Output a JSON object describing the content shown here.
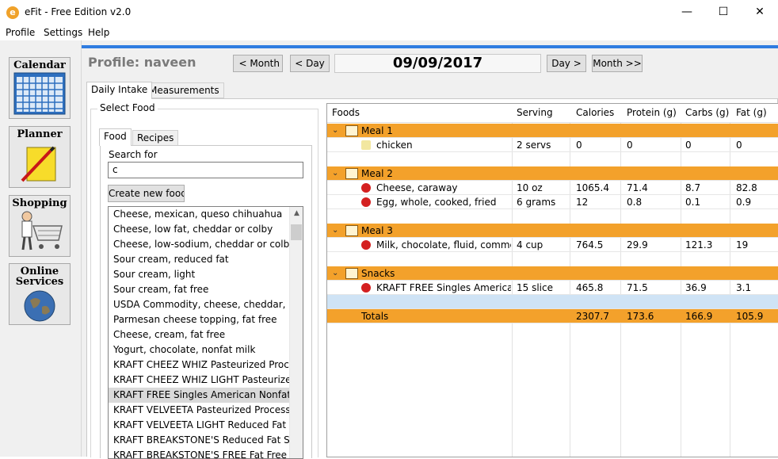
{
  "window": {
    "title": "eFit - Free Edition v2.0",
    "minimize": "—",
    "maximize": "☐",
    "close": "✕",
    "icon_letter": "e"
  },
  "menu": [
    "Profile",
    "Settings",
    "Help"
  ],
  "nav": {
    "calendar": "Calendar",
    "planner": "Planner",
    "shopping": "Shopping",
    "online_1": "Online",
    "online_2": "Services"
  },
  "profile": {
    "label": "Profile: naveen"
  },
  "date_nav": {
    "prev_month": "< Month",
    "prev_day": "< Day",
    "date": "09/09/2017",
    "next_day": "Day >",
    "next_month": "Month >>"
  },
  "tabs": {
    "daily": "Daily Intake",
    "measure": "Measurements"
  },
  "select_food": {
    "group_title": "Select Food",
    "tab_food": "Food",
    "tab_recipes": "Recipes",
    "search_label": "Search for",
    "search_value": "c",
    "create_button": "Create new food",
    "results": [
      "Cheese, mexican, queso chihuahua",
      "Cheese, low fat, cheddar or colby",
      "Cheese, low-sodium, cheddar or colby",
      "Sour cream, reduced fat",
      "Sour cream, light",
      "Sour cream, fat free",
      "USDA Commodity, cheese, cheddar, reduc",
      "Parmesan cheese topping, fat free",
      "Cheese, cream, fat free",
      "Yogurt, chocolate, nonfat milk",
      "KRAFT CHEEZ WHIZ Pasteurized Process C",
      "KRAFT CHEEZ WHIZ LIGHT Pasteurized Pr",
      "KRAFT FREE Singles American Nonfat Past",
      "KRAFT VELVEETA Pasteurized Process Chee",
      "KRAFT VELVEETA LIGHT Reduced Fat Paste",
      "KRAFT BREAKSTONE'S Reduced Fat Sour C",
      "KRAFT BREAKSTONE'S FREE Fat Free Sour"
    ],
    "selected_index": 12
  },
  "grid": {
    "headers": [
      "Foods",
      "Serving",
      "Calories",
      "Protein (g)",
      "Carbs (g)",
      "Fat (g)"
    ],
    "meals": [
      {
        "name": "Meal 1",
        "foods": [
          {
            "name": "chicken",
            "serving": "2 servs",
            "calories": "0",
            "protein": "0",
            "carbs": "0",
            "fat": "0"
          }
        ]
      },
      {
        "name": "Meal 2",
        "foods": [
          {
            "name": "Cheese, caraway",
            "serving": "10 oz",
            "calories": "1065.4",
            "protein": "71.4",
            "carbs": "8.7",
            "fat": "82.8"
          },
          {
            "name": "Egg, whole, cooked, fried",
            "serving": "6 grams",
            "calories": "12",
            "protein": "0.8",
            "carbs": "0.1",
            "fat": "0.9"
          }
        ]
      },
      {
        "name": "Meal 3",
        "foods": [
          {
            "name": "Milk, chocolate, fluid, commerci",
            "serving": "4 cup",
            "calories": "764.5",
            "protein": "29.9",
            "carbs": "121.3",
            "fat": "19"
          }
        ]
      },
      {
        "name": "Snacks",
        "foods": [
          {
            "name": "KRAFT FREE Singles American N",
            "serving": "15 slice",
            "calories": "465.8",
            "protein": "71.5",
            "carbs": "36.9",
            "fat": "3.1"
          }
        ]
      }
    ],
    "totals": {
      "label": "Totals",
      "calories": "2307.7",
      "protein": "173.6",
      "carbs": "166.9",
      "fat": "105.9"
    }
  },
  "colors": {
    "meal_row": "#f3a12b",
    "accent": "#2f7ce0"
  }
}
